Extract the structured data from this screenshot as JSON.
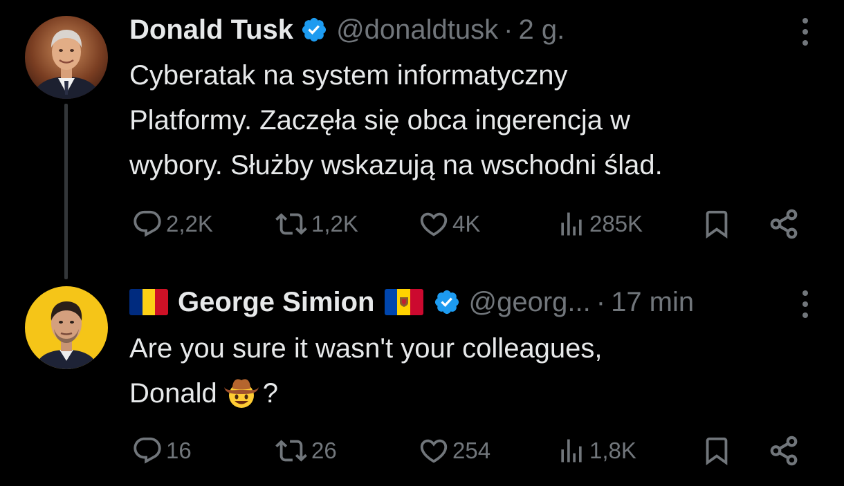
{
  "tweets": [
    {
      "name": "Donald Tusk",
      "handle": "@donaldtusk",
      "separator": "·",
      "time": "2 g.",
      "text": [
        "Cyberatak na system informatyczny",
        "Platformy. Zaczęła się obca ingerencja w",
        "wybory. Służby wskazują na wschodni ślad."
      ],
      "stats": {
        "replies": "2,2K",
        "reposts": "1,2K",
        "likes": "4K",
        "views": "285K"
      }
    },
    {
      "name": "George Simion",
      "handle": "@georg...",
      "separator": "·",
      "time": "17 min",
      "text_line1": "Are you sure it wasn't your colleagues,",
      "text_line2_prefix": "Donald",
      "text_line2_suffix": "?",
      "emoji_icon": "cowboy-hat-face-emoji",
      "flags": [
        "romania-flag",
        "moldova-flag"
      ],
      "stats": {
        "replies": "16",
        "reposts": "26",
        "likes": "254",
        "views": "1,8K"
      }
    }
  ],
  "icons": {
    "verified": "verified-badge-icon",
    "more": "more-vertical-icon",
    "reply": "reply-icon",
    "repost": "repost-icon",
    "like": "heart-icon",
    "views": "views-chart-icon",
    "bookmark": "bookmark-icon",
    "share": "share-icon"
  },
  "colors": {
    "background": "#000000",
    "text": "#e7e9ea",
    "secondary": "#71767b",
    "verified": "#1d9bf0",
    "thread_line": "#333639"
  }
}
